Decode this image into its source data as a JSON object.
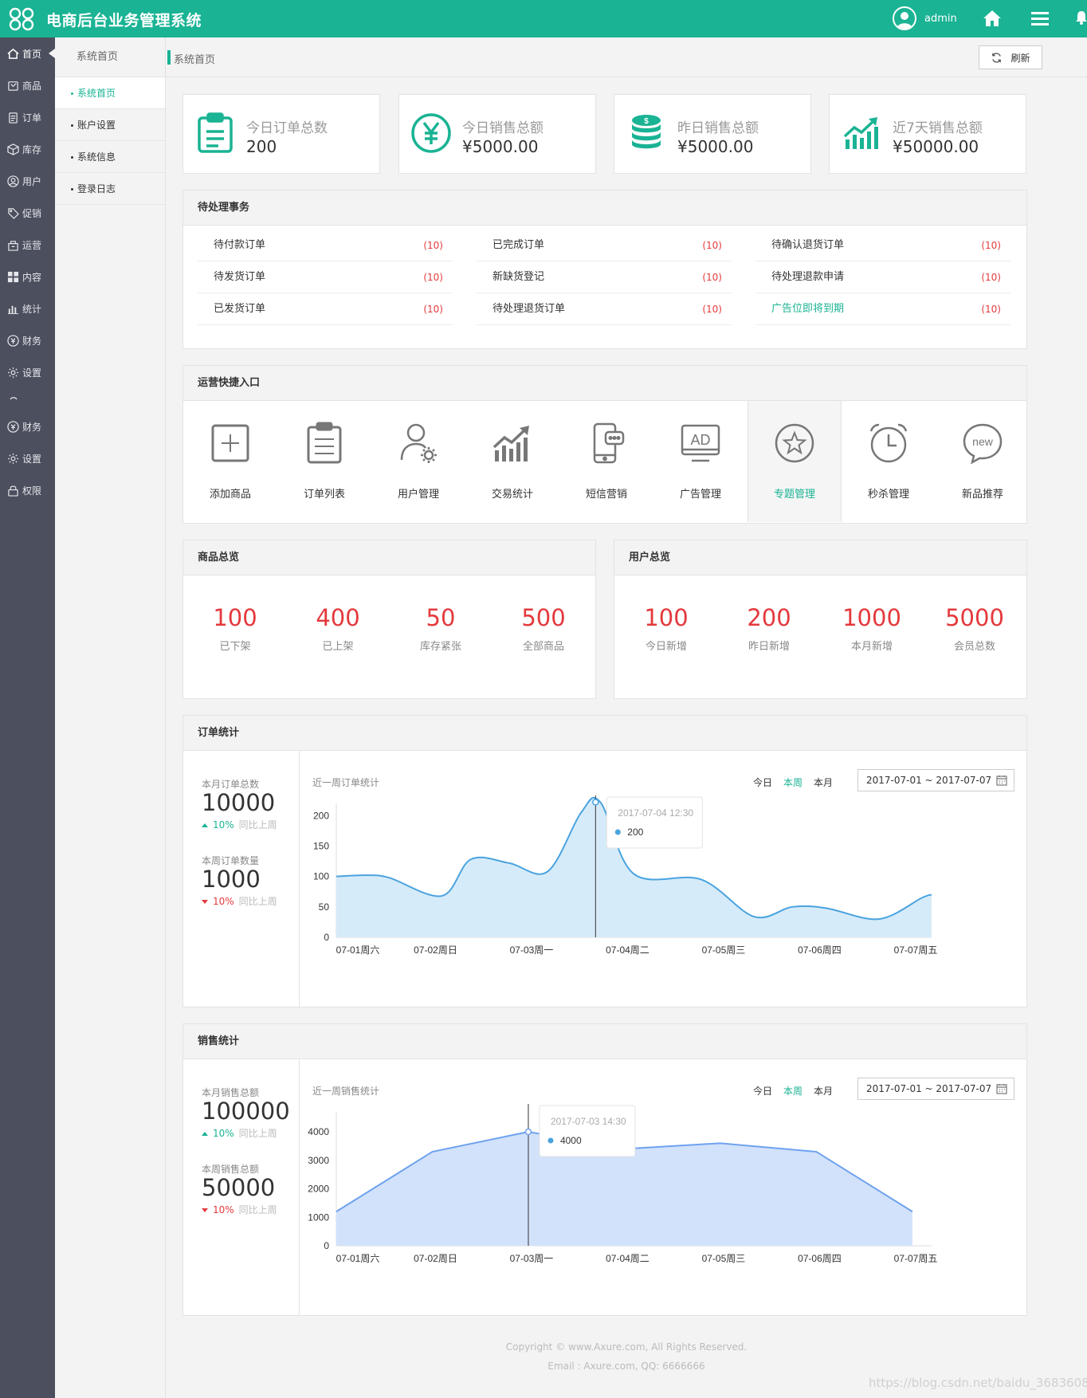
{
  "app": {
    "title": "电商后台业务管理系统",
    "username": "admin",
    "colors": {
      "brand": "#1ab394",
      "sidebar": "#4b4f5e",
      "alert": "#e4393c"
    }
  },
  "sidebar": {
    "items": [
      {
        "label": "首页",
        "icon": "home-icon"
      },
      {
        "label": "商品",
        "icon": "goods-icon"
      },
      {
        "label": "订单",
        "icon": "order-icon"
      },
      {
        "label": "库存",
        "icon": "inventory-icon"
      },
      {
        "label": "用户",
        "icon": "user-icon"
      },
      {
        "label": "促销",
        "icon": "tag-icon"
      },
      {
        "label": "运营",
        "icon": "operation-icon"
      },
      {
        "label": "内容",
        "icon": "grid-icon"
      },
      {
        "label": "统计",
        "icon": "bar-chart-icon"
      },
      {
        "label": "财务",
        "icon": "finance-icon"
      },
      {
        "label": "设置",
        "icon": "gear-icon"
      },
      {
        "label": "财务",
        "icon": "finance-icon"
      },
      {
        "label": "设置",
        "icon": "gear-icon"
      },
      {
        "label": "权限",
        "icon": "lock-icon"
      }
    ]
  },
  "subnav": {
    "title": "系统首页",
    "items": [
      "系统首页",
      "账户设置",
      "系统信息",
      "登录日志"
    ]
  },
  "breadcrumb": {
    "current": "系统首页",
    "refresh": "刷新"
  },
  "stats": [
    {
      "label": "今日订单总数",
      "value": "200",
      "icon": "clipboard-icon"
    },
    {
      "label": "今日销售总额",
      "value": "¥5000.00",
      "icon": "yuan-icon"
    },
    {
      "label": "昨日销售总额",
      "value": "¥5000.00",
      "icon": "coins-icon"
    },
    {
      "label": "近7天销售总额",
      "value": "¥50000.00",
      "icon": "trend-icon"
    }
  ],
  "todo": {
    "title": "待处理事务",
    "columns": [
      [
        {
          "label": "待付款订单",
          "count": "(10)"
        },
        {
          "label": "待发货订单",
          "count": "(10)"
        },
        {
          "label": "已发货订单",
          "count": "(10)"
        }
      ],
      [
        {
          "label": "已完成订单",
          "count": "(10)"
        },
        {
          "label": "新缺货登记",
          "count": "(10)"
        },
        {
          "label": "待处理退货订单",
          "count": "(10)"
        }
      ],
      [
        {
          "label": "待确认退货订单",
          "count": "(10)"
        },
        {
          "label": "待处理退款申请",
          "count": "(10)"
        },
        {
          "label": "广告位即将到期",
          "count": "(10)"
        }
      ]
    ]
  },
  "quick": {
    "title": "运营快捷入口",
    "items": [
      {
        "label": "添加商品",
        "icon": "add-box-icon"
      },
      {
        "label": "订单列表",
        "icon": "order-list-icon"
      },
      {
        "label": "用户管理",
        "icon": "user-gear-icon"
      },
      {
        "label": "交易统计",
        "icon": "trend-bars-icon"
      },
      {
        "label": "短信营销",
        "icon": "phone-message-icon"
      },
      {
        "label": "广告管理",
        "icon": "ad-monitor-icon"
      },
      {
        "label": "专题管理",
        "icon": "star-circle-icon"
      },
      {
        "label": "秒杀管理",
        "icon": "alarm-clock-icon"
      },
      {
        "label": "新品推荐",
        "icon": "new-badge-icon"
      }
    ]
  },
  "goods": {
    "title": "商品总览",
    "items": [
      {
        "value": "100",
        "label": "已下架"
      },
      {
        "value": "400",
        "label": "已上架"
      },
      {
        "value": "50",
        "label": "库存紧张"
      },
      {
        "value": "500",
        "label": "全部商品"
      }
    ]
  },
  "users": {
    "title": "用户总览",
    "items": [
      {
        "value": "100",
        "label": "今日新增"
      },
      {
        "value": "200",
        "label": "昨日新增"
      },
      {
        "value": "1000",
        "label": "本月新增"
      },
      {
        "value": "5000",
        "label": "会员总数"
      }
    ]
  },
  "range_tabs": [
    "今日",
    "本周",
    "本月"
  ],
  "orders": {
    "title": "订单统计",
    "month_label": "本月订单总数",
    "month_value": "10000",
    "month_change": "10%",
    "month_compare": "同比上周",
    "week_label": "本周订单数量",
    "week_value": "1000",
    "week_change": "10%",
    "week_compare": "同比上周",
    "chart_title": "近一周订单统计",
    "date_range": "2017-07-01 ~ 2017-07-07",
    "tooltip": {
      "time": "2017-07-04  12:30",
      "value": "200"
    }
  },
  "sales": {
    "title": "销售统计",
    "month_label": "本月销售总额",
    "month_value": "100000",
    "month_change": "10%",
    "month_compare": "同比上周",
    "week_label": "本周销售总额",
    "week_value": "50000",
    "week_change": "10%",
    "week_compare": "同比上周",
    "chart_title": "近一周销售统计",
    "date_range": "2017-07-01 ~ 2017-07-07",
    "tooltip": {
      "time": "2017-07-03  14:30",
      "value": "4000"
    }
  },
  "chart_data": [
    {
      "type": "area",
      "smooth": true,
      "x": [
        "07-01周六",
        "07-02周日",
        "07-03周一",
        "07-04周二",
        "07-05周三",
        "07-06周四",
        "07-07周五"
      ],
      "x_positions": [
        0,
        1,
        2,
        3,
        4,
        5,
        6
      ],
      "y_ticks": [
        0,
        50,
        100,
        150,
        200
      ],
      "ylim": [
        0,
        220
      ],
      "series": [
        {
          "points": [
            [
              0,
              100
            ],
            [
              0.3,
              102
            ],
            [
              0.55,
              98
            ],
            [
              1.1,
              68
            ],
            [
              1.4,
              128
            ],
            [
              1.8,
              122
            ],
            [
              2.2,
              108
            ],
            [
              2.55,
              205
            ],
            [
              2.75,
              222
            ],
            [
              3.1,
              104
            ],
            [
              3.8,
              95
            ],
            [
              4.35,
              34
            ],
            [
              4.75,
              50
            ],
            [
              5.1,
              48
            ],
            [
              5.65,
              30
            ],
            [
              6.1,
              65
            ],
            [
              6.2,
              70
            ]
          ],
          "color": "#4aa3df",
          "fill": "#d6ebf9"
        }
      ],
      "highlight_x": 2.7,
      "grid": false
    },
    {
      "type": "area",
      "x": [
        "07-01周六",
        "07-02周日",
        "07-03周一",
        "07-04周二",
        "07-05周三",
        "07-06周四",
        "07-07周五"
      ],
      "y_ticks": [
        0,
        1000,
        2000,
        3000,
        4000
      ],
      "ylim": [
        0,
        4700
      ],
      "series": [
        {
          "values": [
            1200,
            3300,
            4000,
            3400,
            3600,
            3300,
            1200
          ],
          "color": "#6ea2ef",
          "fill": "#d2e2fb"
        }
      ],
      "highlight_x": 2,
      "grid": false
    }
  ],
  "footer": {
    "copyright": "Copyright © www.Axure.com, All Rights Reserved.",
    "contact": "Email : Axure.com,  QQ: 6666666"
  },
  "watermark": "https://blog.csdn.net/baidu_36836080"
}
